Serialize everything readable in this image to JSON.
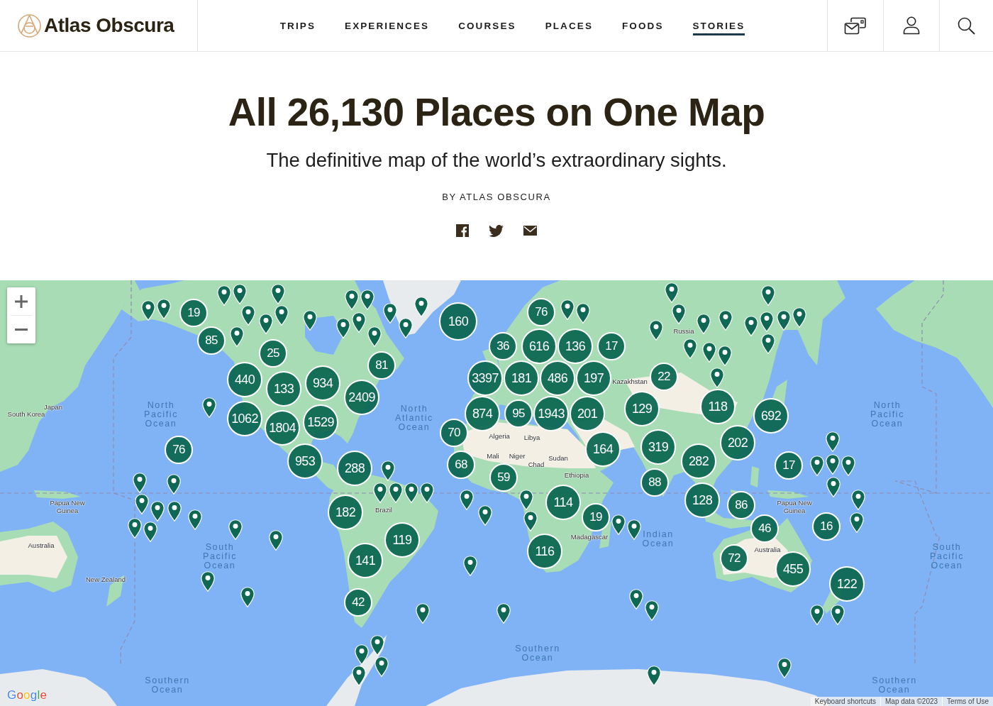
{
  "header": {
    "logo": "Atlas Obscura",
    "nav": [
      {
        "label": "TRIPS",
        "selected": false
      },
      {
        "label": "EXPERIENCES",
        "selected": false
      },
      {
        "label": "COURSES",
        "selected": false
      },
      {
        "label": "PLACES",
        "selected": false
      },
      {
        "label": "FOODS",
        "selected": false
      },
      {
        "label": "STORIES",
        "selected": true
      }
    ]
  },
  "article": {
    "title": "All 26,130 Places on One Map",
    "subtitle": "The definitive map of the world’s extraordinary sights.",
    "byline": "BY ATLAS OBSCURA"
  },
  "map": {
    "clusters": [
      {
        "count": "19"
      },
      {
        "count": "85"
      },
      {
        "count": "25"
      },
      {
        "count": "440"
      },
      {
        "count": "133"
      },
      {
        "count": "934"
      },
      {
        "count": "81"
      },
      {
        "count": "2409"
      },
      {
        "count": "1062"
      },
      {
        "count": "1804"
      },
      {
        "count": "1529"
      },
      {
        "count": "953"
      },
      {
        "count": "76"
      },
      {
        "count": "288"
      },
      {
        "count": "182"
      },
      {
        "count": "119"
      },
      {
        "count": "141"
      },
      {
        "count": "42"
      },
      {
        "count": "160"
      },
      {
        "count": "76"
      },
      {
        "count": "36"
      },
      {
        "count": "616"
      },
      {
        "count": "136"
      },
      {
        "count": "17"
      },
      {
        "count": "3397"
      },
      {
        "count": "181"
      },
      {
        "count": "486"
      },
      {
        "count": "197"
      },
      {
        "count": "874"
      },
      {
        "count": "95"
      },
      {
        "count": "1943"
      },
      {
        "count": "201"
      },
      {
        "count": "70"
      },
      {
        "count": "164"
      },
      {
        "count": "68"
      },
      {
        "count": "59"
      },
      {
        "count": "114"
      },
      {
        "count": "19"
      },
      {
        "count": "116"
      },
      {
        "count": "22"
      },
      {
        "count": "129"
      },
      {
        "count": "319"
      },
      {
        "count": "88"
      },
      {
        "count": "118"
      },
      {
        "count": "692"
      },
      {
        "count": "202"
      },
      {
        "count": "282"
      },
      {
        "count": "17"
      },
      {
        "count": "128"
      },
      {
        "count": "86"
      },
      {
        "count": "46"
      },
      {
        "count": "16"
      },
      {
        "count": "72"
      },
      {
        "count": "455"
      },
      {
        "count": "122"
      }
    ],
    "labels": [
      {
        "text": "South Korea",
        "kind": "country"
      },
      {
        "text": "Japan",
        "kind": "country"
      },
      {
        "text": "North Pacific Ocean",
        "kind": "ocean"
      },
      {
        "text": "Papua New Guinea",
        "kind": "country"
      },
      {
        "text": "Australia",
        "kind": "country"
      },
      {
        "text": "New Zealand",
        "kind": "country"
      },
      {
        "text": "South Pacific Ocean",
        "kind": "ocean"
      },
      {
        "text": "Southern Ocean",
        "kind": "ocean"
      },
      {
        "text": "North Atlantic Ocean",
        "kind": "ocean"
      },
      {
        "text": "Brazil",
        "kind": "country"
      },
      {
        "text": "Algeria",
        "kind": "country"
      },
      {
        "text": "Libya",
        "kind": "country"
      },
      {
        "text": "Mali",
        "kind": "country"
      },
      {
        "text": "Niger",
        "kind": "country"
      },
      {
        "text": "Chad",
        "kind": "country"
      },
      {
        "text": "Sudan",
        "kind": "country"
      },
      {
        "text": "Ethiopia",
        "kind": "country"
      },
      {
        "text": "Madagascar",
        "kind": "country"
      },
      {
        "text": "Russia",
        "kind": "country"
      },
      {
        "text": "Kazakhstan",
        "kind": "country"
      },
      {
        "text": "Indian Ocean",
        "kind": "ocean"
      },
      {
        "text": "Southern Ocean",
        "kind": "ocean"
      },
      {
        "text": "Papua New Guinea",
        "kind": "country"
      },
      {
        "text": "Australia",
        "kind": "country"
      },
      {
        "text": "North Pacific Ocean",
        "kind": "ocean"
      },
      {
        "text": "South Pacific Ocean",
        "kind": "ocean"
      },
      {
        "text": "Southern Ocean",
        "kind": "ocean"
      }
    ],
    "logo": "Google",
    "attribution": [
      "Keyboard shortcuts",
      "Map data ©2023",
      "Terms of Use"
    ]
  }
}
